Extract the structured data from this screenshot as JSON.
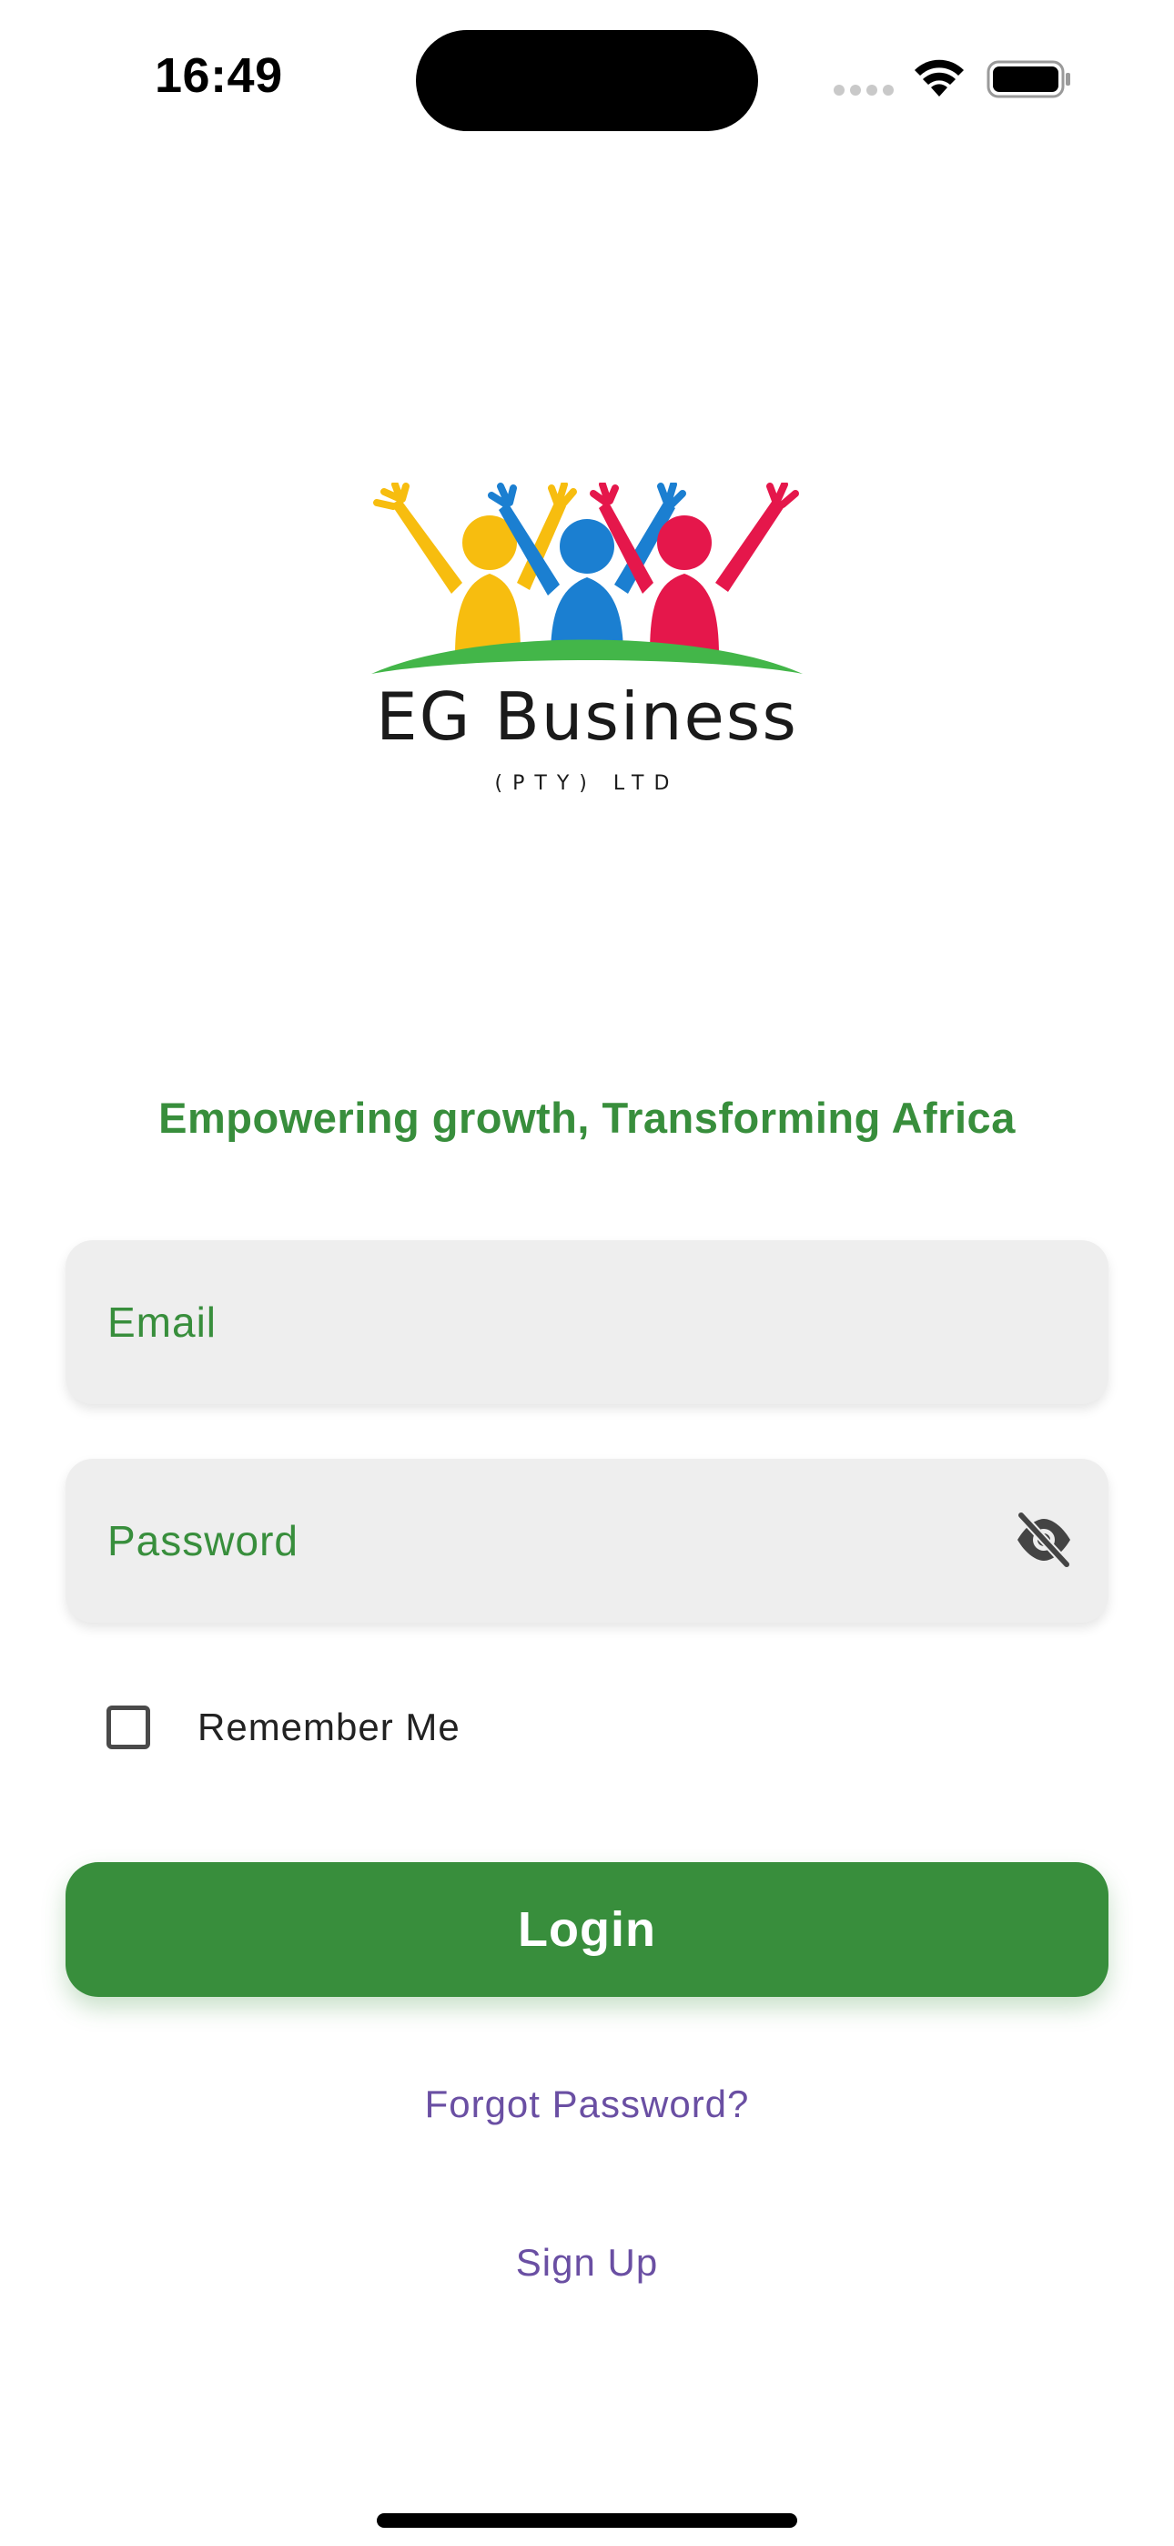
{
  "status_bar": {
    "time": "16:49"
  },
  "logo": {
    "title": "EG Business",
    "subtitle": "(PTY) LTD",
    "colors": [
      "#f7bd0f",
      "#1b7fd1",
      "#e5174b",
      "#43b649"
    ]
  },
  "tagline": "Empowering growth, Transforming Africa",
  "form": {
    "email": {
      "value": "",
      "placeholder": "Email"
    },
    "password": {
      "value": "",
      "placeholder": "Password",
      "toggle_icon": "eye-off-icon"
    },
    "remember_me": {
      "label": "Remember Me",
      "checked": false
    },
    "login_label": "Login",
    "forgot_password_label": "Forgot Password?",
    "sign_up_label": "Sign Up"
  },
  "colors": {
    "primary": "#388e3c",
    "link": "#6a4fa3",
    "field_bg": "#eeeeee"
  }
}
